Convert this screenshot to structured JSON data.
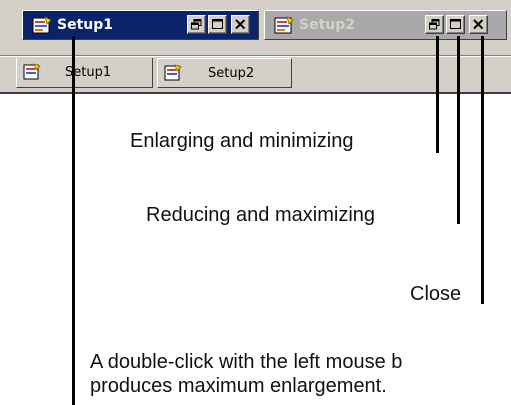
{
  "windows": [
    {
      "title": "Setup1",
      "state": "active"
    },
    {
      "title": "Setup2",
      "state": "inactive"
    }
  ],
  "tabs": [
    {
      "label": "Setup1"
    },
    {
      "label": "Setup2"
    }
  ],
  "annotations": {
    "restore": "Enlarging and minimizing",
    "maximize": "Reducing and maximizing",
    "close": "Close",
    "double_click_line1": "A double-click with the left mouse b",
    "double_click_line2": "produces maximum enlargement."
  },
  "colors": {
    "active_titlebar": "#0a246a",
    "inactive_titlebar": "#a9a9a9",
    "chrome": "#d4d0c8"
  }
}
